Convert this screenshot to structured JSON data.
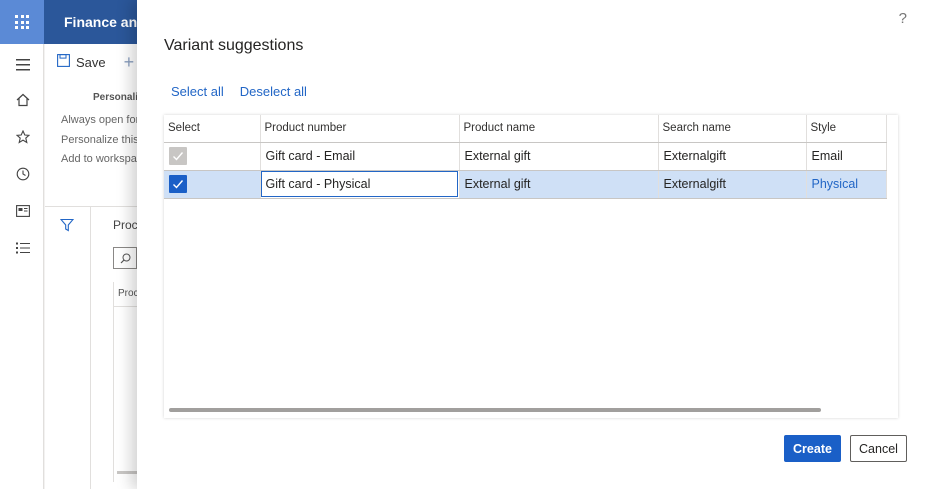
{
  "app": {
    "title": "Finance and",
    "toolbar": {
      "save_label": "Save"
    },
    "personalize_label": "Personaliz",
    "side_links": [
      "Always open for",
      "Personalize this",
      "Add to workspa"
    ],
    "list_label": "Proc",
    "grid_col_label": "Proc"
  },
  "dialog": {
    "title": "Variant suggestions",
    "help_label": "?",
    "links": {
      "select_all": "Select all",
      "deselect_all": "Deselect all"
    },
    "table": {
      "columns": [
        "Select",
        "Product number",
        "Product name",
        "Search name",
        "Style"
      ],
      "rows": [
        {
          "selected": true,
          "disabled": true,
          "product_number": "Gift card - Email",
          "product_name": "External gift",
          "search_name": "Externalgift",
          "style": "Email"
        },
        {
          "selected": true,
          "disabled": false,
          "product_number": "Gift card - Physical",
          "product_name": "External gift",
          "search_name": "Externalgift",
          "style": "Physical"
        }
      ]
    },
    "buttons": {
      "create": "Create",
      "cancel": "Cancel"
    }
  },
  "colors": {
    "accent": "#1a5fc7",
    "topbar": "#2b579a",
    "row_selected": "#cfe0f6",
    "link": "#2266c6"
  }
}
